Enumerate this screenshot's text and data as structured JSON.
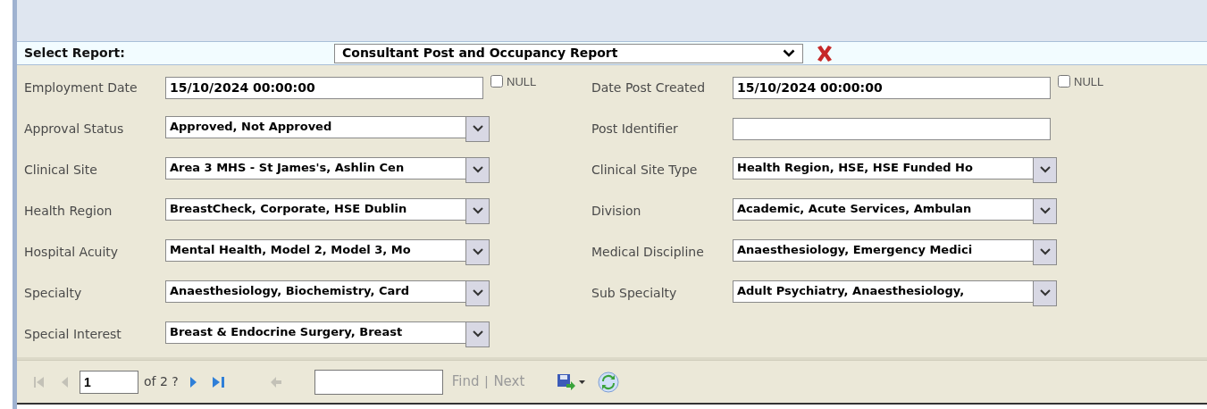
{
  "report_selector": {
    "label": "Select Report:",
    "value": "Consultant Post and Occupancy Report"
  },
  "left_fields": [
    {
      "kind": "date",
      "label": "Employment Date",
      "value": "15/10/2024 00:00:00",
      "null_label": "NULL",
      "null_checked": false
    },
    {
      "kind": "multiselect",
      "label": "Approval Status",
      "value": "Approved, Not Approved"
    },
    {
      "kind": "multiselect",
      "label": "Clinical Site",
      "value": "Area 3 MHS - St James's, Ashlin Cen"
    },
    {
      "kind": "multiselect",
      "label": "Health Region",
      "value": "BreastCheck, Corporate, HSE Dublin"
    },
    {
      "kind": "multiselect",
      "label": "Hospital Acuity",
      "value": "Mental Health, Model 2, Model 3, Mo"
    },
    {
      "kind": "multiselect",
      "label": "Specialty",
      "value": "Anaesthesiology, Biochemistry, Card"
    },
    {
      "kind": "multiselect",
      "label": "Special Interest",
      "value": "Breast & Endocrine Surgery, Breast"
    }
  ],
  "right_fields": [
    {
      "kind": "date",
      "label": "Date Post Created",
      "value": "15/10/2024 00:00:00",
      "null_label": "NULL",
      "null_checked": false
    },
    {
      "kind": "text",
      "label": "Post Identifier"
    },
    {
      "kind": "multiselect",
      "label": "Clinical Site Type",
      "value": "Health Region, HSE, HSE Funded Ho"
    },
    {
      "kind": "multiselect",
      "label": "Division",
      "value": "Academic, Acute Services, Ambulan"
    },
    {
      "kind": "multiselect",
      "label": "Medical Discipline",
      "value": "Anaesthesiology, Emergency Medici"
    },
    {
      "kind": "multiselect",
      "label": "Sub Specialty",
      "value": "Adult Psychiatry, Anaesthesiology,"
    }
  ],
  "toolbar": {
    "first_disabled": true,
    "previous_disabled": true,
    "page": "1",
    "page_count": "of 2 ?",
    "next_disabled": false,
    "last_disabled": false,
    "back_disabled": true,
    "find_disabled": true,
    "find_label": "Find",
    "separator": "|",
    "next_label": "Next"
  }
}
